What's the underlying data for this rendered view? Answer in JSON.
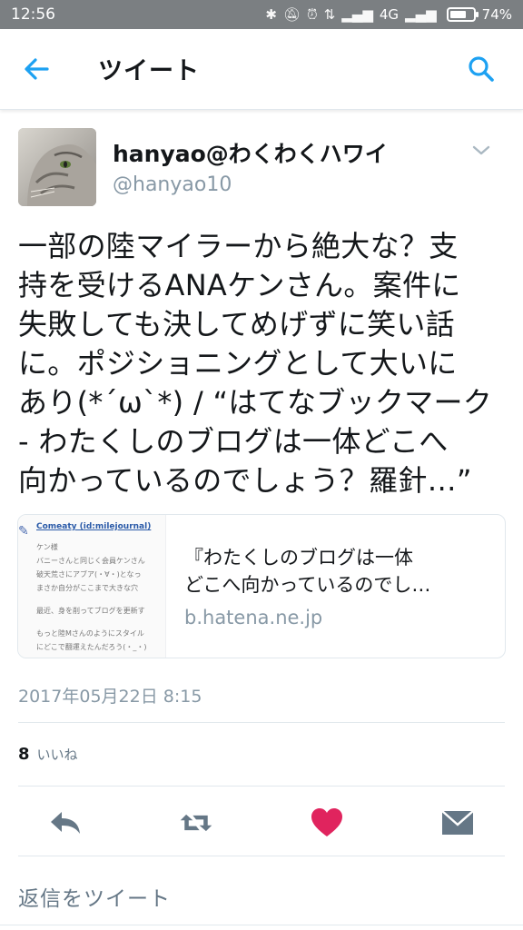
{
  "status_bar": {
    "time": "12:56",
    "network": "4G",
    "battery": "74%",
    "battery_level": 0.74
  },
  "header": {
    "title": "ツイート",
    "back_icon": "back-arrow-icon",
    "search_icon": "search-icon"
  },
  "tweet": {
    "display_name": "hanyao@わくわくハワイ",
    "handle": "@hanyao10",
    "text_lines": [
      "一部の陸マイラーから絶大な？支",
      "持を受けるANAケンさん。案件に",
      "失敗しても決してめげずに笑い話",
      "に。ポジショニングとして大いに",
      "あり(*´ω`*) / “はてなブックマーク",
      "- わたくしのブログは一体どこへ",
      "向かっているのでしょう？羅針…”"
    ],
    "card": {
      "title_lines": [
        "『わたくしのブログは一体",
        "どこへ向かっているのでし…"
      ],
      "domain": "b.hatena.ne.jp",
      "thumb_lines": [
        "Comeaty (id:milejournal)",
        "ケン様",
        "バニーさんと同じく会員ケンさん",
        "破天荒さにアブア(・∀・)となっ",
        "まさか自分がここまで大きな穴",
        "最近、身を削ってブログを更新す",
        "もっと陸Mさんのようにスタイル",
        "にどこで翻運えたんだろう(・_・)"
      ]
    },
    "timestamp": "2017年05月22日 8:15",
    "likes_count": "8",
    "likes_label": "いいね"
  },
  "actions": {
    "reply_icon": "reply-icon",
    "retweet_icon": "retweet-icon",
    "like_icon": "heart-icon",
    "dm_icon": "envelope-icon"
  },
  "reply_placeholder": "返信をツイート",
  "colors": {
    "accent": "#1da1f2",
    "like": "#e0245e",
    "icon_gray": "#657786",
    "status_bar": "#7b7f82"
  }
}
